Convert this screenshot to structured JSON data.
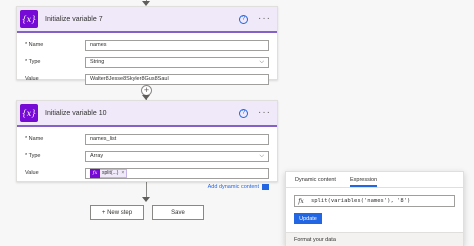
{
  "actions": [
    {
      "title": "Initialize variable 7",
      "fields": {
        "name_label": "* Name",
        "name_value": "names",
        "type_label": "* Type",
        "type_value": "String",
        "value_label": "Value",
        "value_value": "Walter8Jesse8Skyler8Gus8Saul"
      }
    },
    {
      "title": "Initialize variable 10",
      "fields": {
        "name_label": "* Name",
        "name_value": "names_list",
        "type_label": "* Type",
        "type_value": "Array",
        "value_label": "Value",
        "token_label": "split(...)",
        "token_remove": "×"
      },
      "add_dynamic_content": "Add dynamic content"
    }
  ],
  "icons": {
    "variable": "{x}",
    "fx": "fx",
    "help": "?",
    "more": "···",
    "chevron": "⌵",
    "plus": "+"
  },
  "buttons": {
    "new_step": "+ New step",
    "save": "Save"
  },
  "expression_panel": {
    "tabs": [
      "Dynamic content",
      "Expression"
    ],
    "active_tab": "Expression",
    "expression": "split(variables('names'), '8')",
    "update_label": "Update",
    "footer": "Format your data"
  },
  "colors": {
    "accent_purple": "#770bd6",
    "header_bg": "#f0e9f9",
    "link_blue": "#2266e3"
  }
}
